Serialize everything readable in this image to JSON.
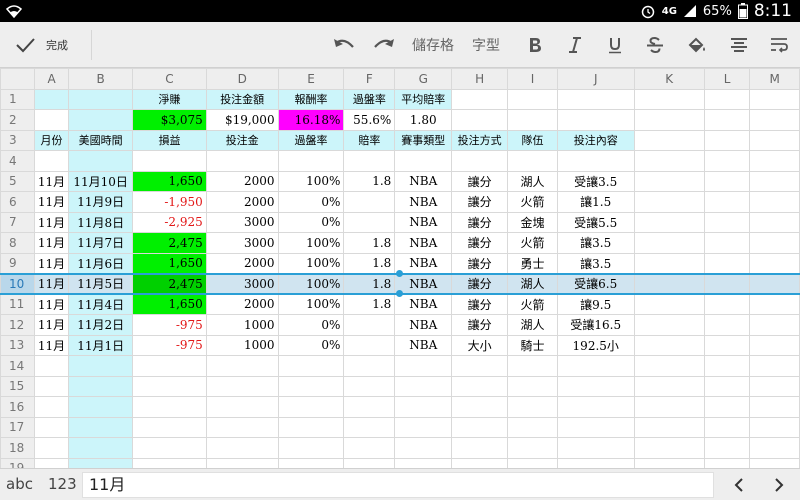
{
  "status_bar": {
    "network": "4G",
    "battery": "65%",
    "time": "8:11",
    "icons": [
      "wifi-icon",
      "alarm-icon",
      "signal-icon",
      "battery-icon"
    ]
  },
  "toolbar": {
    "done_label": "完成",
    "save_label": "儲存格",
    "font_label": "字型"
  },
  "columns": [
    "",
    "A",
    "B",
    "C",
    "D",
    "E",
    "F",
    "G",
    "H",
    "I",
    "J",
    "K",
    "L",
    "M"
  ],
  "rows": [
    {
      "n": "1",
      "cells": [
        "",
        "",
        "淨賺",
        "投注金額",
        "報酬率",
        "過盤率",
        "平均賠率",
        "",
        "",
        "",
        "",
        "",
        ""
      ]
    },
    {
      "n": "2",
      "cells": [
        "",
        "",
        "$3,075",
        "$19,000",
        "16.18%",
        "55.6%",
        "1.80",
        "",
        "",
        "",
        "",
        "",
        ""
      ]
    },
    {
      "n": "3",
      "cells": [
        "月份",
        "美國時間",
        "損益",
        "投注金",
        "過盤率",
        "賠率",
        "賽事類型",
        "投注方式",
        "隊伍",
        "投注內容",
        "",
        "",
        ""
      ]
    },
    {
      "n": "4",
      "cells": [
        "",
        "",
        "",
        "",
        "",
        "",
        "",
        "",
        "",
        "",
        "",
        "",
        ""
      ]
    },
    {
      "n": "5",
      "cells": [
        "11月",
        "11月10日",
        "1,650",
        "2000",
        "100%",
        "1.8",
        "NBA",
        "讓分",
        "湖人",
        "受讓3.5",
        "",
        "",
        ""
      ]
    },
    {
      "n": "6",
      "cells": [
        "11月",
        "11月9日",
        "-1,950",
        "2000",
        "0%",
        "",
        "NBA",
        "讓分",
        "火箭",
        "讓1.5",
        "",
        "",
        ""
      ]
    },
    {
      "n": "7",
      "cells": [
        "11月",
        "11月8日",
        "-2,925",
        "3000",
        "0%",
        "",
        "NBA",
        "讓分",
        "金塊",
        "受讓5.5",
        "",
        "",
        ""
      ]
    },
    {
      "n": "8",
      "cells": [
        "11月",
        "11月7日",
        "2,475",
        "3000",
        "100%",
        "1.8",
        "NBA",
        "讓分",
        "火箭",
        "讓3.5",
        "",
        "",
        ""
      ]
    },
    {
      "n": "9",
      "cells": [
        "11月",
        "11月6日",
        "1,650",
        "2000",
        "100%",
        "1.8",
        "NBA",
        "讓分",
        "勇士",
        "讓3.5",
        "",
        "",
        ""
      ]
    },
    {
      "n": "10",
      "cells": [
        "11月",
        "11月5日",
        "2,475",
        "3000",
        "100%",
        "1.8",
        "NBA",
        "讓分",
        "湖人",
        "受讓6.5",
        "",
        "",
        ""
      ]
    },
    {
      "n": "11",
      "cells": [
        "11月",
        "11月4日",
        "1,650",
        "2000",
        "100%",
        "1.8",
        "NBA",
        "讓分",
        "火箭",
        "讓9.5",
        "",
        "",
        ""
      ]
    },
    {
      "n": "12",
      "cells": [
        "11月",
        "11月2日",
        "-975",
        "1000",
        "0%",
        "",
        "NBA",
        "讓分",
        "湖人",
        "受讓16.5",
        "",
        "",
        ""
      ]
    },
    {
      "n": "13",
      "cells": [
        "11月",
        "11月1日",
        "-975",
        "1000",
        "0%",
        "",
        "NBA",
        "大小",
        "騎士",
        "192.5小",
        "",
        "",
        ""
      ]
    },
    {
      "n": "14",
      "cells": [
        "",
        "",
        "",
        "",
        "",
        "",
        "",
        "",
        "",
        "",
        "",
        "",
        ""
      ]
    },
    {
      "n": "15",
      "cells": [
        "",
        "",
        "",
        "",
        "",
        "",
        "",
        "",
        "",
        "",
        "",
        "",
        ""
      ]
    },
    {
      "n": "16",
      "cells": [
        "",
        "",
        "",
        "",
        "",
        "",
        "",
        "",
        "",
        "",
        "",
        "",
        ""
      ]
    },
    {
      "n": "17",
      "cells": [
        "",
        "",
        "",
        "",
        "",
        "",
        "",
        "",
        "",
        "",
        "",
        "",
        ""
      ]
    },
    {
      "n": "18",
      "cells": [
        "",
        "",
        "",
        "",
        "",
        "",
        "",
        "",
        "",
        "",
        "",
        "",
        ""
      ]
    },
    {
      "n": "19",
      "cells": [
        "",
        "",
        "",
        "",
        "",
        "",
        "",
        "",
        "",
        "",
        "",
        "",
        ""
      ]
    }
  ],
  "selected_row": "10",
  "bottom_bar": {
    "abc": "abc",
    "num": "123",
    "formula_value": "11月"
  },
  "colors": {
    "green": "#00f000",
    "magenta": "#ff00ff",
    "cyan": "#ccf5fa",
    "negative": "#e21818",
    "selection": "#2a9fd6"
  }
}
